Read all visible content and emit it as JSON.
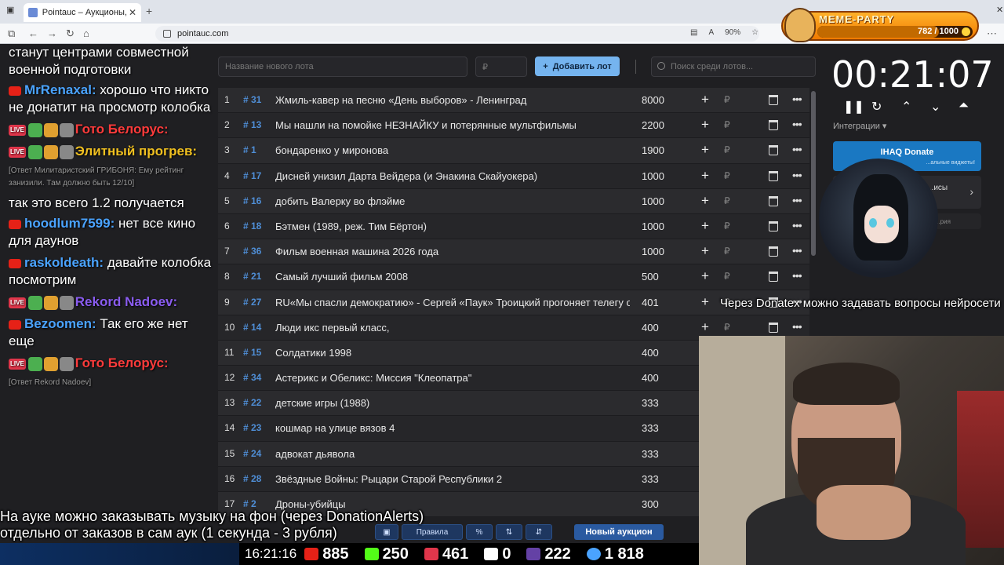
{
  "browser": {
    "tab_title": "Pointauc – Аукционы, лотерея",
    "url": "pointauc.com",
    "zoom": "90%"
  },
  "meme_party": {
    "title": "MEME-PARTY",
    "progress": "782 / 1000",
    "progress_fraction": 0.782
  },
  "chat": [
    {
      "text": "станут центрами совместной военной подготовки",
      "nick": "",
      "nick_color": "#ffffff",
      "type": "cont"
    },
    {
      "nick": "MrRenaxal:",
      "text": " хорошо что никто не донатит на просмотр колобка",
      "nick_color": "#4aa3ff",
      "type": "yt"
    },
    {
      "nick": "Гото Белорус:",
      "text": "",
      "nick_color": "#ff3b3b",
      "type": "live"
    },
    {
      "nick": "Элитный прогрев:",
      "text": "",
      "nick_color": "#f0c020",
      "type": "live"
    },
    {
      "text": "[Ответ Милитаристский ГРИБОНЯ: Ему рейтинг занизили. Там должно быть 12/10]",
      "type": "small"
    },
    {
      "text": "так это всего 1.2 получается",
      "type": "plain"
    },
    {
      "nick": "hoodlum7599:",
      "text": " нет все кино для даунов",
      "nick_color": "#4aa3ff",
      "type": "yt"
    },
    {
      "nick": "raskoldeath:",
      "text": " давайте колобка посмотрим",
      "nick_color": "#4aa3ff",
      "type": "yt"
    },
    {
      "nick": "Rekord Nadoev:",
      "text": "",
      "nick_color": "#8a5cf0",
      "type": "live"
    },
    {
      "nick": "Bezoomen:",
      "text": " Так его же нет еще",
      "nick_color": "#4aa3ff",
      "type": "yt"
    },
    {
      "nick": "Гото Белорус:",
      "text": "",
      "nick_color": "#ff3b3b",
      "type": "live"
    },
    {
      "text": "[Ответ Rekord Nadoev]",
      "type": "small"
    }
  ],
  "toolbar": {
    "lot_placeholder": "Название нового лота",
    "price_placeholder": "₽",
    "add_label": "Добавить лот",
    "search_placeholder": "Поиск среди лотов..."
  },
  "lots": [
    {
      "idx": "1",
      "num": "# 31",
      "name": "Жмиль-кавер на песню «День выборов» - Ленинград",
      "amount": "8000"
    },
    {
      "idx": "2",
      "num": "# 13",
      "name": "Мы нашли на помойке НЕЗНАЙКУ и потерянные мультфильмы",
      "amount": "2200"
    },
    {
      "idx": "3",
      "num": "# 1",
      "name": "бондаренко у миронова",
      "amount": "1900"
    },
    {
      "idx": "4",
      "num": "# 17",
      "name": "Дисней унизил Дарта Вейдера (и Энакина Скайуокера)",
      "amount": "1000"
    },
    {
      "idx": "5",
      "num": "# 16",
      "name": "добить Валерку во флэйме",
      "amount": "1000"
    },
    {
      "idx": "6",
      "num": "# 18",
      "name": "Бэтмен (1989, реж. Тим Бёртон)",
      "amount": "1000"
    },
    {
      "idx": "7",
      "num": "# 36",
      "name": "Фильм военная машина 2026 года",
      "amount": "1000"
    },
    {
      "idx": "8",
      "num": "# 21",
      "name": "Самый лучший фильм 2008",
      "amount": "500"
    },
    {
      "idx": "9",
      "num": "# 27",
      "name": "RU«Мы спасли демократию» - Сергей «Паук» Троицкий прогоняет телегу о",
      "amount": "401"
    },
    {
      "idx": "10",
      "num": "# 14",
      "name": "Люди икс первый класс,",
      "amount": "400"
    },
    {
      "idx": "11",
      "num": "# 15",
      "name": "Солдатики 1998",
      "amount": "400"
    },
    {
      "idx": "12",
      "num": "# 34",
      "name": "Астерикс и Обеликс: Миссия \"Клеопатра\"",
      "amount": "400"
    },
    {
      "idx": "13",
      "num": "# 22",
      "name": "детские игры (1988)",
      "amount": "333"
    },
    {
      "idx": "14",
      "num": "# 23",
      "name": "кошмар на улице вязов 4",
      "amount": "333"
    },
    {
      "idx": "15",
      "num": "# 24",
      "name": "адвокат дьявола",
      "amount": "333"
    },
    {
      "idx": "16",
      "num": "# 28",
      "name": "Звёздные Войны: Рыцари Старой Республики 2",
      "amount": "333"
    },
    {
      "idx": "17",
      "num": "# 2",
      "name": "Дроны-убийцы",
      "amount": "300"
    }
  ],
  "bottom_toolbar": {
    "rules": "Правила",
    "new_auction": "Новый аукцион",
    "percent": "%"
  },
  "right": {
    "timer": "00:21:07",
    "integrations": "Интеграции",
    "donate_title": "IHAQ Donate",
    "donate_sub": "...альные виджеты!",
    "card2_text": "...исы",
    "card3_text": "...рия"
  },
  "captions": {
    "donatex": "Через Donatex можно задавать вопросы нейросети",
    "bottom_line1": "На ауке можно заказывать музыку на фон (через DonationAlerts)",
    "bottom_line2": "отдельно от заказов в сам аук (1 секунда - 3 рубля)"
  },
  "stats": {
    "time": "16:21:16",
    "youtube": "885",
    "kick": "250",
    "vk": "461",
    "rutube": "0",
    "twitch": "222",
    "total": "1 818"
  }
}
